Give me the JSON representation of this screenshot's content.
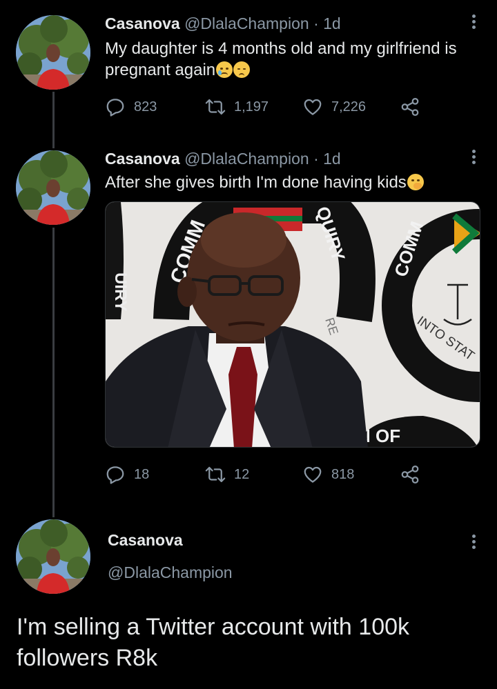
{
  "tweets": [
    {
      "name": "Casanova",
      "handle": "@DlalaChampion",
      "time": "· 1d",
      "text": "My daughter is 4 months old and my girlfriend is pregnant again",
      "emojis": [
        "crying-face-emoji",
        "pensive-face-emoji"
      ],
      "replies": "823",
      "retweets": "1,197",
      "likes": "7,226"
    },
    {
      "name": "Casanova",
      "handle": "@DlalaChampion",
      "time": "· 1d",
      "text": "After she gives birth I'm done having kids",
      "emojis": [
        "hand-over-mouth-emoji"
      ],
      "media": {
        "signage_words": [
          "COMM",
          "UIRY",
          "QUIRY",
          "RE",
          "COMM",
          "INTO STAT",
          "N OF"
        ]
      },
      "replies": "18",
      "retweets": "12",
      "likes": "818"
    }
  ],
  "main_tweet": {
    "name": "Casanova",
    "handle": "@DlalaChampion",
    "text": "I'm selling a Twitter account with 100k followers R8k"
  },
  "colors": {
    "background": "#000000",
    "text": "#e7e9ea",
    "muted": "#8b98a5",
    "thread_line": "#3a3d41"
  }
}
